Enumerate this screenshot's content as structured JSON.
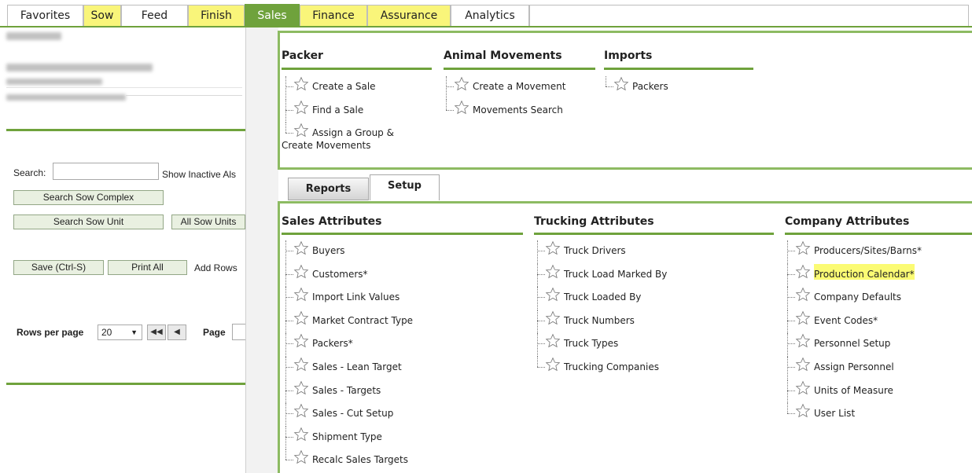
{
  "nav": {
    "tabs": [
      {
        "label": "Favorites",
        "style": "plain"
      },
      {
        "label": "Sow",
        "style": "yellow"
      },
      {
        "label": "Feed",
        "style": "plain"
      },
      {
        "label": "Finish",
        "style": "yellow"
      },
      {
        "label": "Sales",
        "style": "active"
      },
      {
        "label": "Finance",
        "style": "yellow"
      },
      {
        "label": "Assurance",
        "style": "yellow"
      },
      {
        "label": "Analytics",
        "style": "plain"
      }
    ]
  },
  "left": {
    "search_label": "Search:",
    "search_value": "",
    "show_inactive": "Show Inactive Als",
    "search_sow_complex": "Search Sow Complex",
    "search_sow_unit": "Search Sow Unit",
    "all_sow_units": "All Sow Units",
    "save": "Save (Ctrl-S)",
    "print_all": "Print All",
    "add_rows": "Add Rows",
    "rows_per_page_label": "Rows per page",
    "rows_per_page_value": "20",
    "page_label": "Page"
  },
  "packer": {
    "title": "Packer",
    "items": [
      "Create a Sale",
      "Find a Sale",
      "Assign a Group &",
      "Create Movements"
    ]
  },
  "animal_movements": {
    "title": "Animal Movements",
    "items": [
      "Create a Movement",
      "Movements Search"
    ]
  },
  "imports": {
    "title": "Imports",
    "items": [
      "Packers"
    ]
  },
  "subtabs": {
    "reports": "Reports",
    "setup": "Setup"
  },
  "sales_attributes": {
    "title": "Sales Attributes",
    "items": [
      "Buyers",
      "Customers*",
      "Import Link Values",
      "Market Contract Type",
      "Packers*",
      "Sales - Lean Target",
      "Sales - Targets",
      "Sales - Cut Setup",
      "Shipment Type",
      "Recalc Sales Targets"
    ]
  },
  "trucking_attributes": {
    "title": "Trucking Attributes",
    "items": [
      "Truck Drivers",
      "Truck Load Marked By",
      "Truck Loaded By",
      "Truck Numbers",
      "Truck Types",
      "Trucking Companies"
    ]
  },
  "company_attributes": {
    "title": "Company Attributes",
    "items": [
      "Producers/Sites/Barns*",
      "Production Calendar*",
      "Company Defaults",
      "Event Codes*",
      "Personnel Setup",
      "Assign Personnel",
      "Units of Measure",
      "User List"
    ],
    "highlighted": "Production Calendar*"
  },
  "colors": {
    "accent_green": "#6fa23c",
    "tab_yellow": "#f9f57a",
    "highlight_yellow": "#fbfb74"
  },
  "icons": {
    "favorite": "star-outline-icon"
  }
}
